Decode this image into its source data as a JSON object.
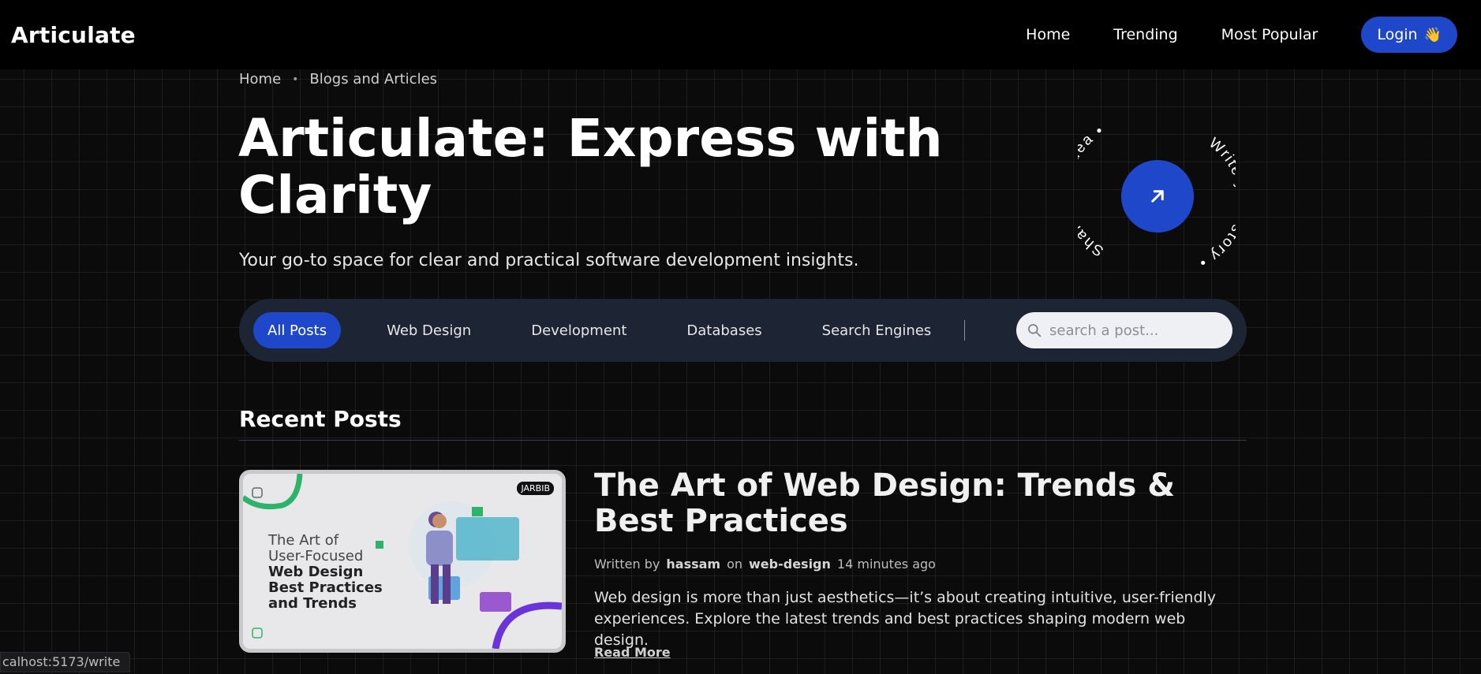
{
  "nav": {
    "brand": "Articulate",
    "links": [
      "Home",
      "Trending",
      "Most Popular"
    ],
    "login_label": "Login",
    "login_emoji": "👋"
  },
  "breadcrumb": {
    "items": [
      "Home",
      "Blogs and Articles"
    ],
    "separator": "•"
  },
  "hero": {
    "title_line1": "Articulate: Express with",
    "title_line2": "Clarity",
    "subtitle": "Your go-to space for clear and practical software development insights."
  },
  "badge": {
    "text_left": "Share your idea •",
    "text_right": "Write your story •",
    "icon": "arrow-up-right-icon"
  },
  "filters": {
    "items": [
      "All Posts",
      "Web Design",
      "Development",
      "Databases",
      "Search Engines"
    ],
    "active": "All Posts",
    "search_placeholder": "search a post...",
    "search_icon": "search-icon"
  },
  "recent": {
    "title": "Recent Posts"
  },
  "post": {
    "thumb_lines": [
      "The Art of",
      "User-Focused",
      "Web Design",
      "Best Practices",
      "and Trends"
    ],
    "thumb_logo": "JARBIB",
    "title": "The Art of Web Design: Trends & Best Practices",
    "meta_written_by": "Written by",
    "author": "hassam",
    "meta_on": "on",
    "category": "web-design",
    "time_ago": "14 minutes ago",
    "excerpt": "Web design is more than just aesthetics—it’s about creating intuitive, user-friendly experiences. Explore the latest trends and best practices shaping modern web design.",
    "read_more": "Read More"
  },
  "status_bar": {
    "url": "calhost:5173/write"
  },
  "colors": {
    "accent": "#1f47c9",
    "filter_bar": "#1d2433",
    "background": "#0b0b0c"
  }
}
